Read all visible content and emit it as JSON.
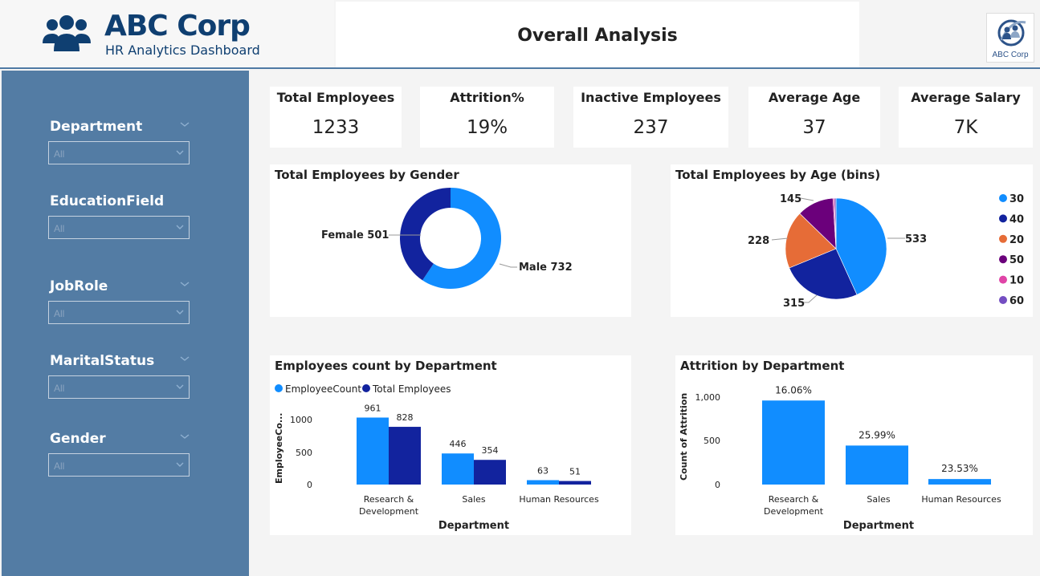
{
  "header": {
    "brand": "ABC Corp",
    "subtitle": "HR Analytics Dashboard",
    "page_title": "Overall Analysis",
    "corner_logo_text": "ABC Corp"
  },
  "filters": [
    {
      "label": "Department",
      "value": "All"
    },
    {
      "label": "EducationField",
      "value": "All"
    },
    {
      "label": "JobRole",
      "value": "All"
    },
    {
      "label": "MaritalStatus",
      "value": "All"
    },
    {
      "label": "Gender",
      "value": "All"
    }
  ],
  "kpis": [
    {
      "title": "Total Employees",
      "value": "1233"
    },
    {
      "title": "Attrition%",
      "value": "19%"
    },
    {
      "title": "Inactive Employees",
      "value": "237"
    },
    {
      "title": "Average Age",
      "value": "37"
    },
    {
      "title": "Average Salary",
      "value": "7K"
    }
  ],
  "colors": {
    "light_blue": "#118dff",
    "dark_blue": "#12239e",
    "orange": "#e66c37",
    "purple": "#6b007b",
    "pink": "#e044a7",
    "violet": "#744ec2",
    "sidebar": "#537ca4",
    "brand": "#0f3f71"
  },
  "chart_data": [
    {
      "type": "pie",
      "title": "Total Employees by Gender",
      "donut": true,
      "categories": [
        "Male",
        "Female"
      ],
      "values": [
        732,
        501
      ],
      "labels": [
        "Male 732",
        "Female 501"
      ],
      "colors": [
        "#118dff",
        "#12239e"
      ]
    },
    {
      "type": "pie",
      "title": "Total Employees by Age (bins)",
      "categories": [
        "30",
        "40",
        "20",
        "50",
        "10",
        "60"
      ],
      "values": [
        533,
        315,
        228,
        145,
        6,
        6
      ],
      "data_labels": [
        "533",
        "315",
        "228",
        "145",
        "",
        ""
      ],
      "colors": [
        "#118dff",
        "#12239e",
        "#e66c37",
        "#6b007b",
        "#e044a7",
        "#744ec2"
      ],
      "legend": "right"
    },
    {
      "type": "bar",
      "title": "Employees count by Department",
      "categories": [
        "Research & Development",
        "Sales",
        "Human Resources"
      ],
      "series": [
        {
          "name": "EmployeeCount",
          "values": [
            961,
            446,
            63
          ],
          "color": "#118dff"
        },
        {
          "name": "Total Employees",
          "values": [
            828,
            354,
            51
          ],
          "color": "#12239e"
        }
      ],
      "xlabel": "Department",
      "ylabel": "EmployeeCo...",
      "yticks": [
        "0",
        "500",
        "1000"
      ],
      "ylim": [
        0,
        1100
      ],
      "legend": "top-left"
    },
    {
      "type": "bar",
      "title": "Attrition by Department",
      "categories": [
        "Research & Development",
        "Sales",
        "Human Resources"
      ],
      "values": [
        961,
        446,
        63
      ],
      "data_labels": [
        "16.06%",
        "25.99%",
        "23.53%"
      ],
      "xlabel": "Department",
      "ylabel": "Count of Attrition",
      "yticks": [
        "0",
        "500",
        "1,000"
      ],
      "ylim": [
        0,
        1100
      ],
      "color": "#118dff"
    }
  ]
}
